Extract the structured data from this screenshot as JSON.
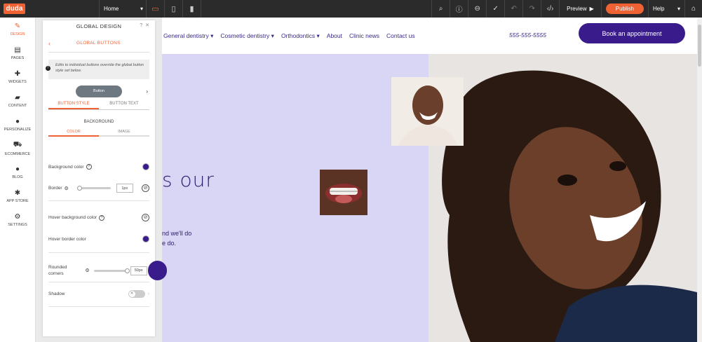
{
  "topbar": {
    "logo": "duda",
    "page_select": "Home",
    "preview": "Preview",
    "publish": "Publish",
    "help": "Help"
  },
  "leftnav": {
    "items": [
      {
        "label": "DESIGN",
        "icon": "brush-icon"
      },
      {
        "label": "PAGES",
        "icon": "pages-icon"
      },
      {
        "label": "WIDGETS",
        "icon": "plus-icon"
      },
      {
        "label": "CONTENT",
        "icon": "folder-icon"
      },
      {
        "label": "PERSONALIZE",
        "icon": "person-icon"
      },
      {
        "label": "ECOMMERCE",
        "icon": "cart-icon"
      },
      {
        "label": "BLOG",
        "icon": "chat-icon"
      },
      {
        "label": "APP STORE",
        "icon": "puzzle-icon"
      },
      {
        "label": "SETTINGS",
        "icon": "gear-icon"
      }
    ]
  },
  "panel": {
    "title": "GLOBAL DESIGN",
    "subtitle": "GLOBAL BUTTONS",
    "info": "Edits to individual buttons override the global button style set below.",
    "button_preview": "Button",
    "tabs": [
      "BUTTON STYLE",
      "BUTTON TEXT"
    ],
    "section": "BACKGROUND",
    "subtabs": [
      "COLOR",
      "IMAGE"
    ],
    "bg_color_label": "Background color",
    "border_label": "Border",
    "border_value": "1px",
    "hover_bg_label": "Hover background color",
    "hover_border_label": "Hover border color",
    "rounded_label_1": "Rounded",
    "rounded_label_2": "corners",
    "rounded_value": "50px",
    "shadow_label": "Shadow",
    "colors": {
      "swatch": "#3a1b8c",
      "accent": "#ef6234"
    }
  },
  "site": {
    "nav": [
      "General dentistry",
      "Cosmetic dentistry",
      "Orthodontics",
      "About",
      "Clinic news",
      "Contact us"
    ],
    "phone": "555-555-5555",
    "book": "Book an appointment",
    "headline": "s  our",
    "body_line_1": "nd we'll do",
    "body_line_2": "e do."
  }
}
